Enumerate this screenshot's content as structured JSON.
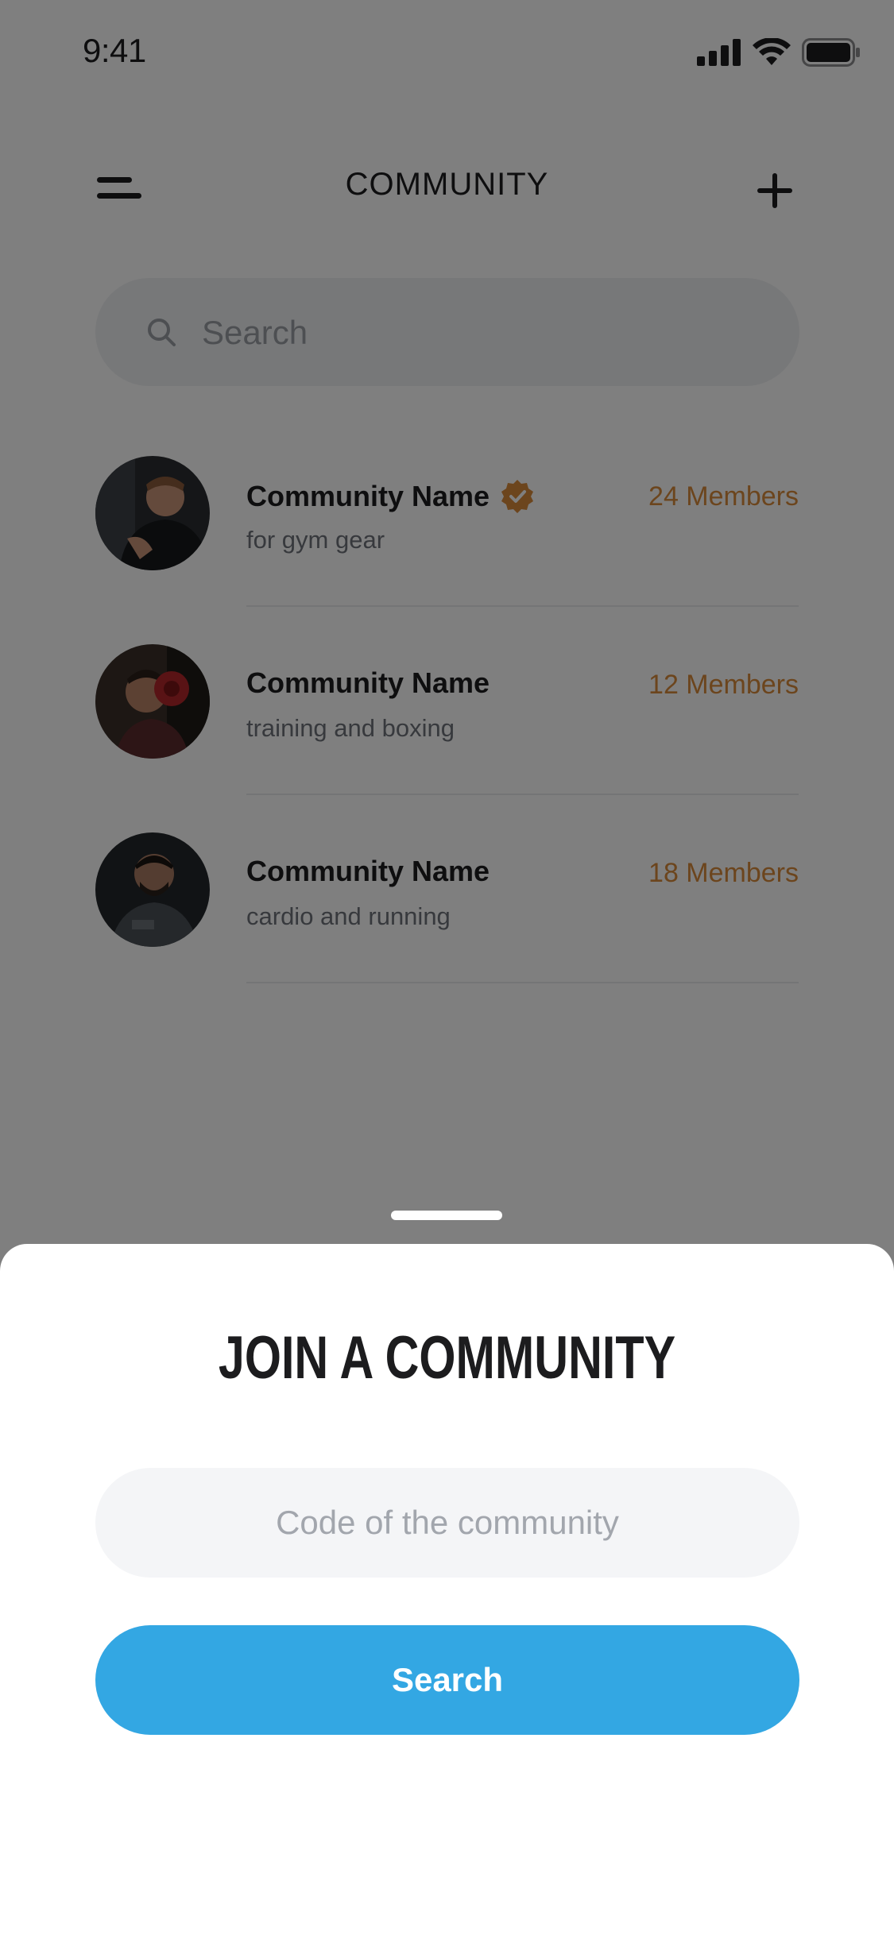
{
  "status_bar": {
    "time": "9:41",
    "icons": [
      "signal-icon",
      "wifi-icon",
      "battery-icon"
    ]
  },
  "header": {
    "title": "COMMUNITY",
    "menu_icon": "menu-icon",
    "add_icon": "plus-icon"
  },
  "search": {
    "placeholder": "Search",
    "value": ""
  },
  "communities": [
    {
      "name": "Community Name",
      "verified": true,
      "description": "for gym gear",
      "members": "24 Members"
    },
    {
      "name": "Community Name",
      "verified": false,
      "description": "training and boxing",
      "members": "12 Members"
    },
    {
      "name": "Community Name",
      "verified": false,
      "description": "cardio and running",
      "members": "18 Members"
    }
  ],
  "join_sheet": {
    "title": "JOIN A COMMUNITY",
    "code_placeholder": "Code of the community",
    "code_value": "",
    "button_label": "Search"
  },
  "colors": {
    "accent": "#33a7e3",
    "members": "#d88a3a",
    "verified_badge": "#d88a3a",
    "overlay": "rgba(0,0,0,0.5)"
  }
}
